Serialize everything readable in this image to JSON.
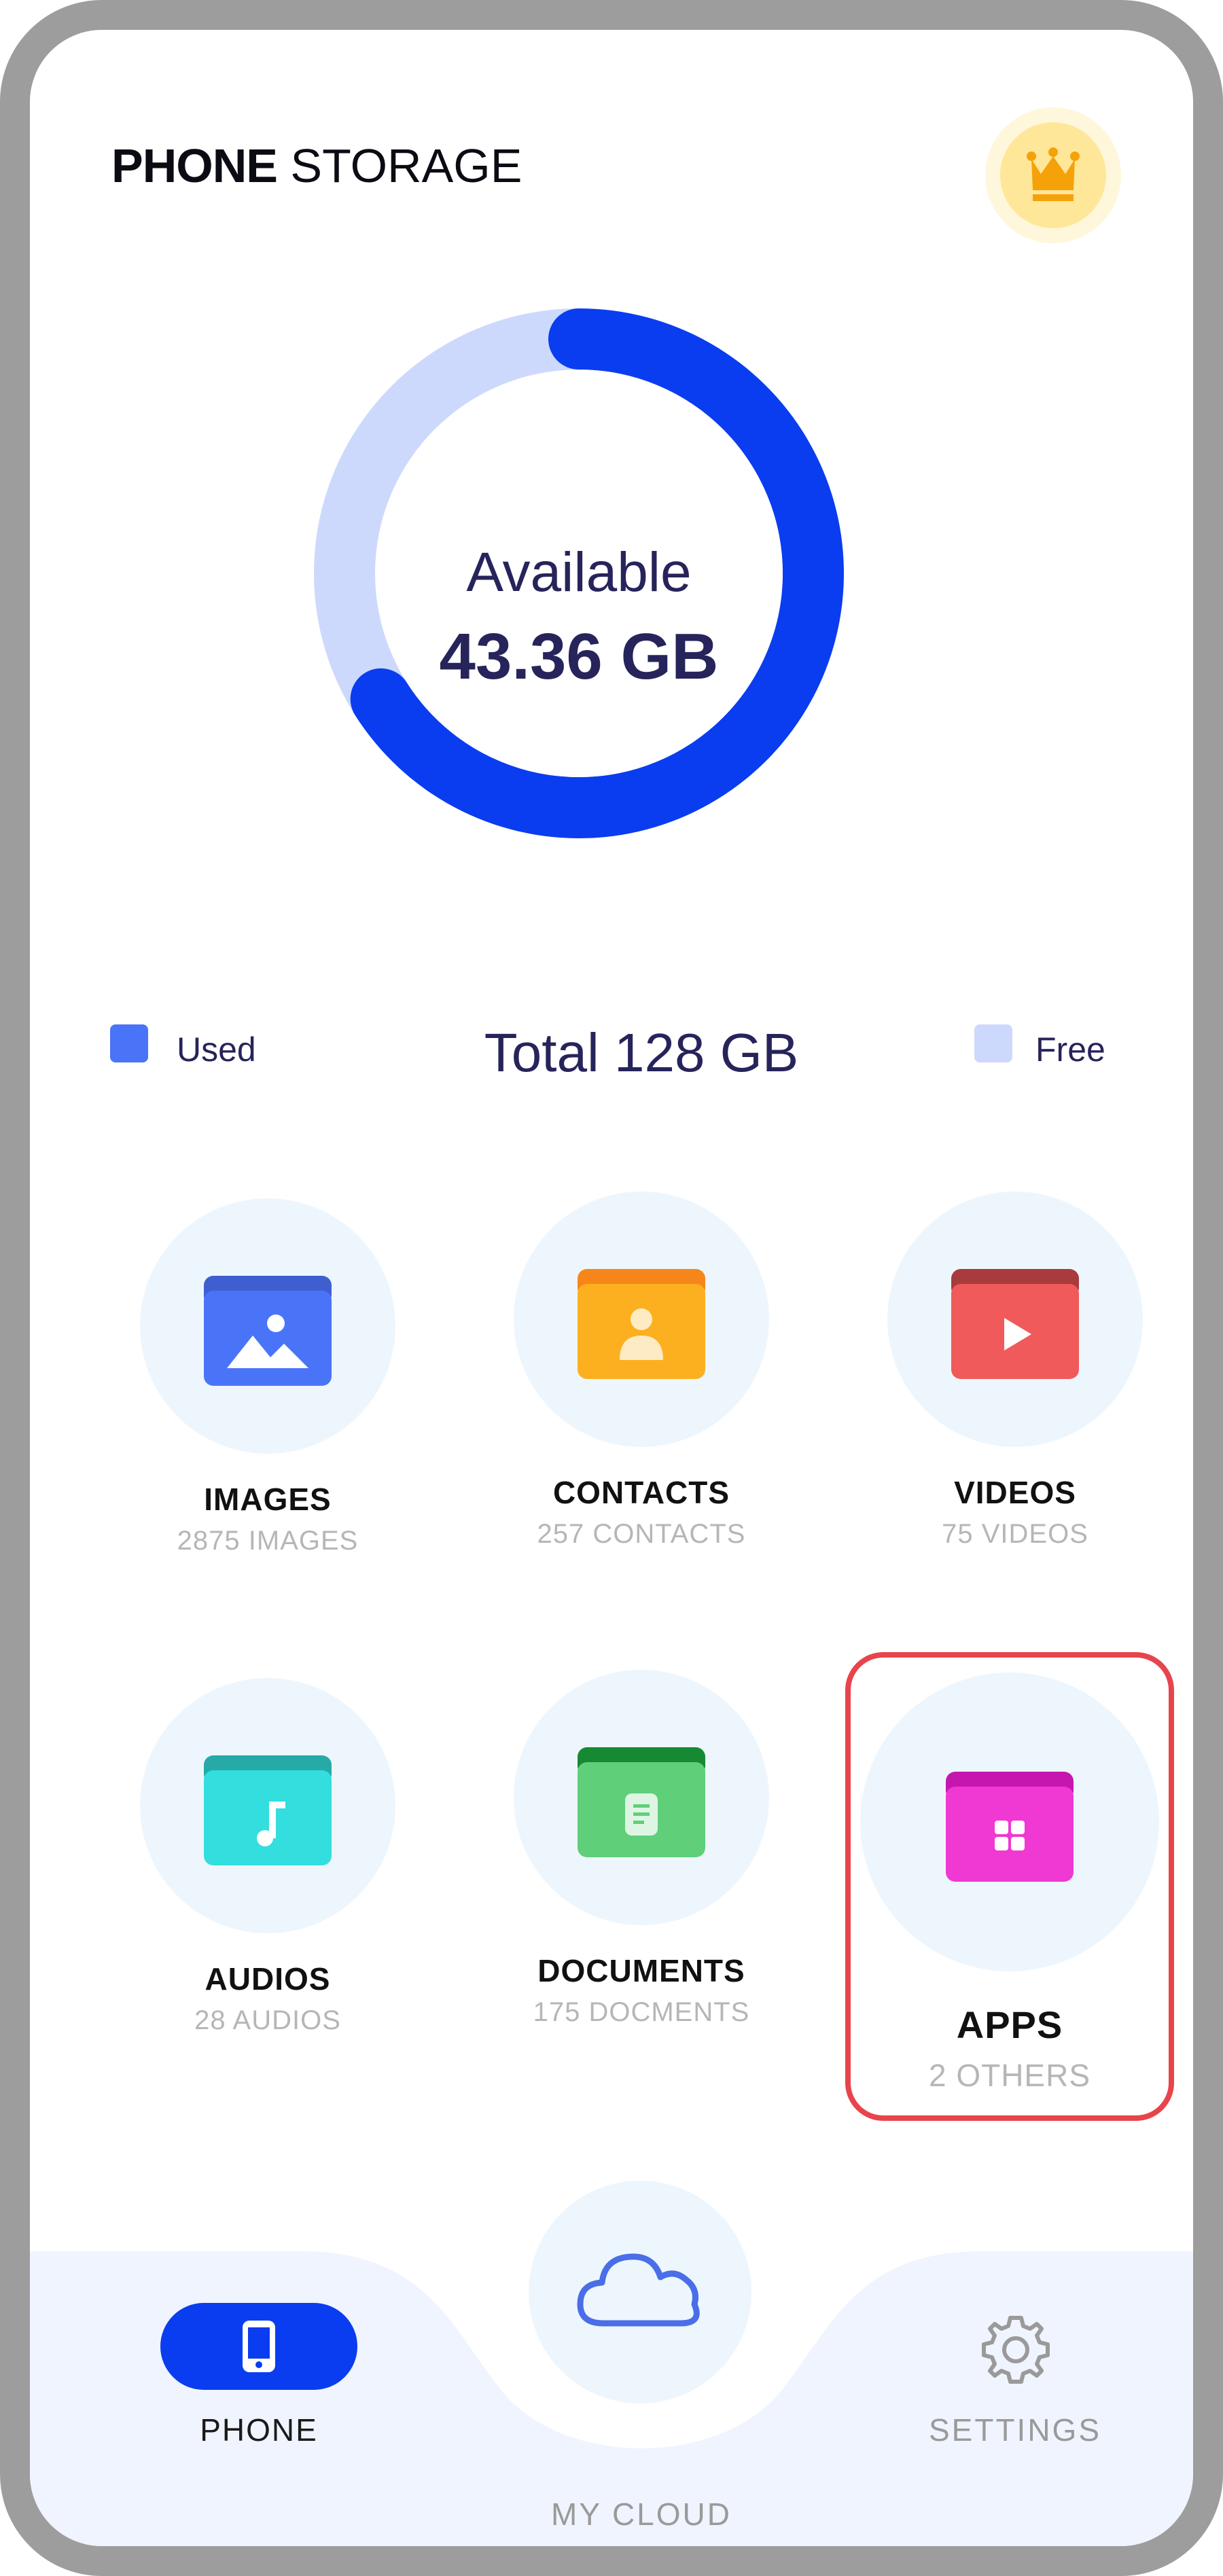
{
  "header": {
    "title_bold": "PHONE",
    "title_light": "STORAGE",
    "premium_icon": "crown-icon"
  },
  "storage": {
    "available_label": "Available",
    "available_value": "43.36 GB",
    "used_fraction": 0.66,
    "total_label": "Total 128 GB",
    "legend": {
      "used": "Used",
      "free": "Free"
    },
    "colors": {
      "used": "#0a3df0",
      "free": "#cdd9fc",
      "used_legend": "#4a74f8"
    }
  },
  "categories": [
    {
      "name": "IMAGES",
      "count": "2875 IMAGES",
      "icon": "image-folder-icon",
      "color": "#4a74f8",
      "tab": "#3f5fd0"
    },
    {
      "name": "CONTACTS",
      "count": "257 CONTACTS",
      "icon": "contacts-folder-icon",
      "color": "#fcb01f",
      "tab": "#f7861a"
    },
    {
      "name": "VIDEOS",
      "count": "75 VIDEOS",
      "icon": "video-folder-icon",
      "color": "#f15a5a",
      "tab": "#a83c3c"
    },
    {
      "name": "AUDIOS",
      "count": "28 AUDIOS",
      "icon": "audio-folder-icon",
      "color": "#33dede",
      "tab": "#26aaa8"
    },
    {
      "name": "DOCUMENTS",
      "count": "175 DOCMENTS",
      "icon": "document-folder-icon",
      "color": "#5fcf7a",
      "tab": "#168a33"
    },
    {
      "name": "APPS",
      "count": "2 OTHERS",
      "icon": "apps-folder-icon",
      "color": "#f038d2",
      "tab": "#c616b0"
    }
  ],
  "nav": {
    "phone": "PHONE",
    "cloud": "MY CLOUD",
    "settings": "SETTINGS",
    "phone_icon": "phone-icon",
    "cloud_icon": "cloud-icon",
    "settings_icon": "gear-icon",
    "active": "PHONE"
  }
}
